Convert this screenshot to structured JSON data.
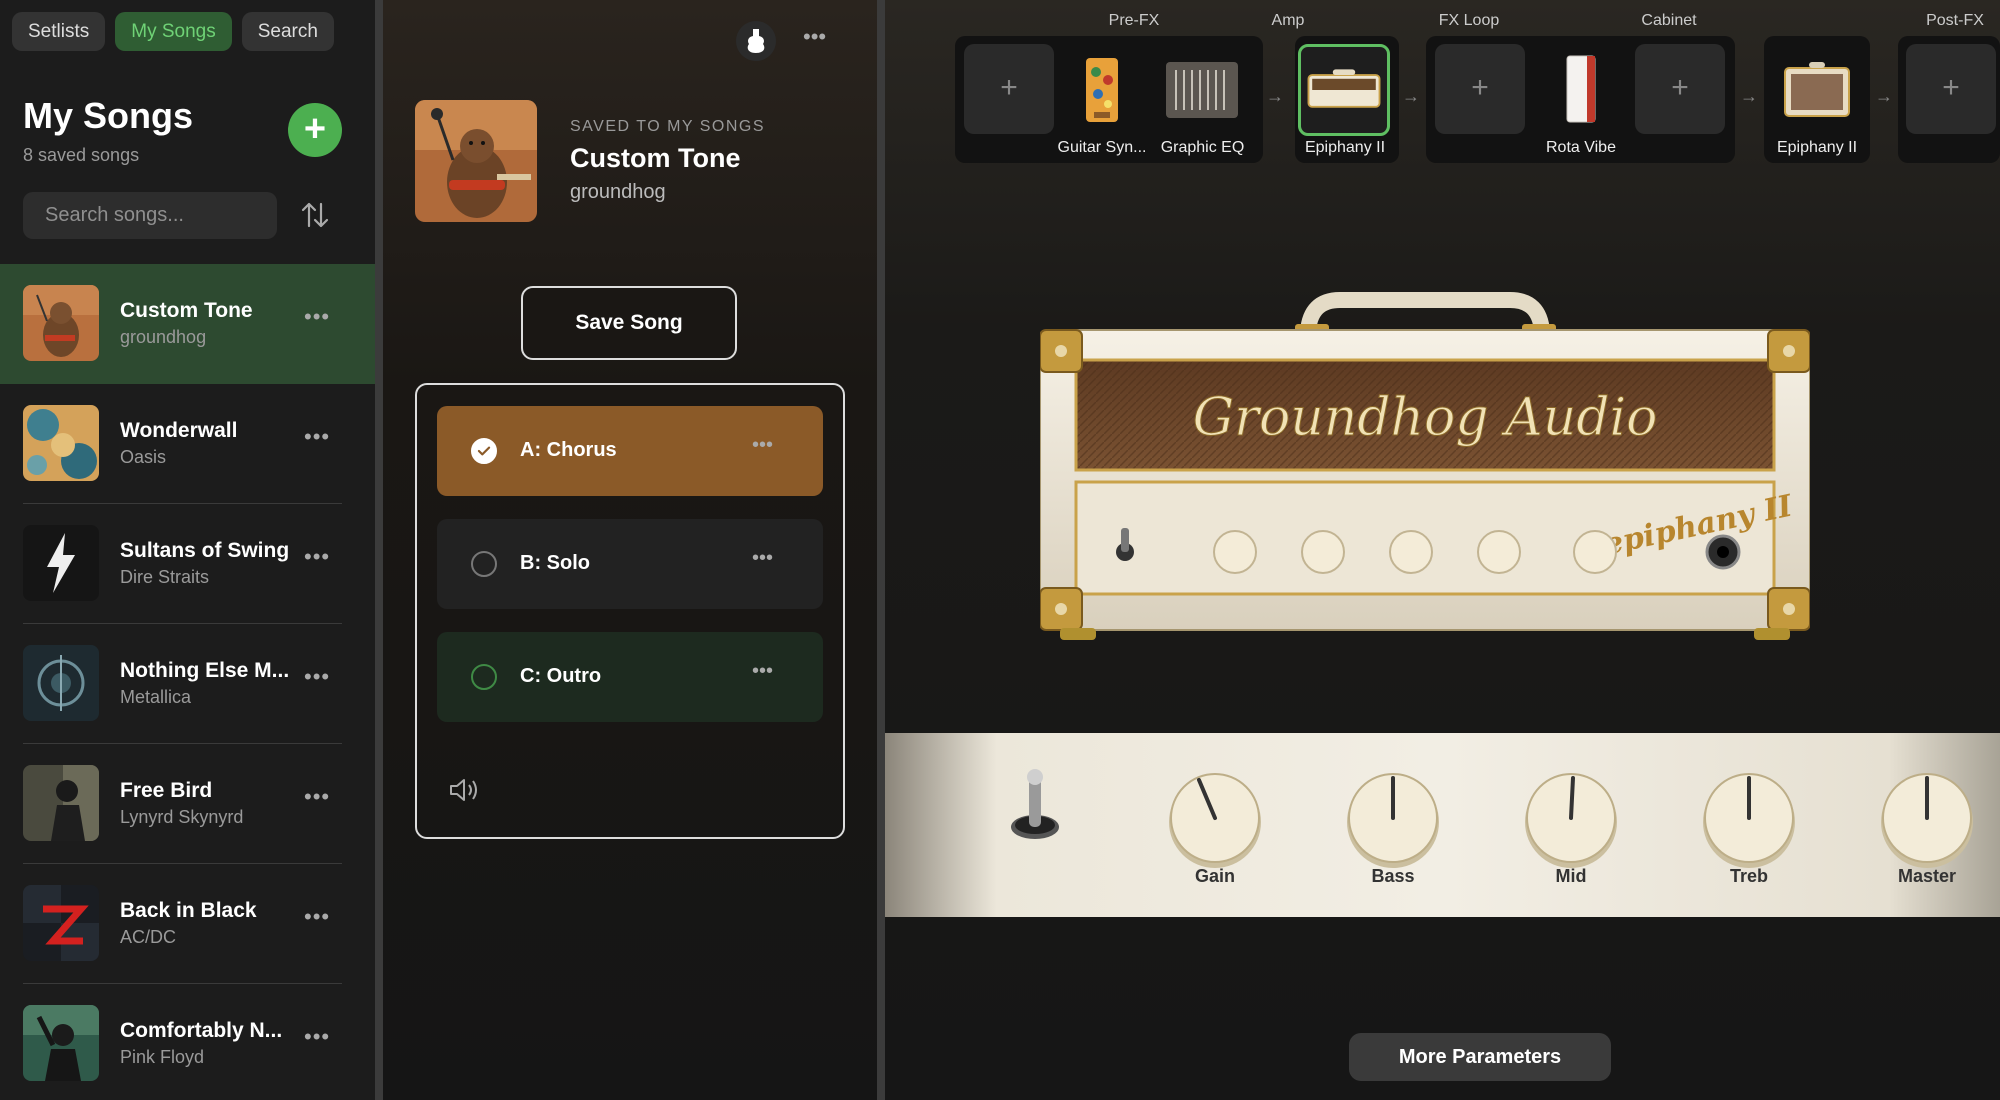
{
  "top_tabs": [
    {
      "label": "Setlists"
    },
    {
      "label": "My Songs"
    },
    {
      "label": "Search"
    }
  ],
  "sidebar": {
    "title": "My Songs",
    "count": "8 saved songs",
    "search_placeholder": "Search songs...",
    "songs": [
      {
        "title": "Custom Tone",
        "artist": "groundhog",
        "active": true
      },
      {
        "title": "Wonderwall",
        "artist": "Oasis"
      },
      {
        "title": "Sultans of Swing",
        "artist": "Dire Straits"
      },
      {
        "title": "Nothing Else M...",
        "artist": "Metallica"
      },
      {
        "title": "Free Bird",
        "artist": "Lynyrd Skynyrd"
      },
      {
        "title": "Back in Black",
        "artist": "AC/DC"
      },
      {
        "title": "Comfortably N...",
        "artist": "Pink Floyd"
      }
    ],
    "more_glyph": "•••"
  },
  "middle": {
    "saved_label": "SAVED TO MY SONGS",
    "title": "Custom Tone",
    "artist": "groundhog",
    "save_button": "Save Song",
    "more_glyph": "•••",
    "parts": [
      {
        "label": "A: Chorus",
        "state": "active"
      },
      {
        "label": "B: Solo",
        "state": "inactive"
      },
      {
        "label": "C: Outro",
        "state": "green"
      }
    ]
  },
  "chain": {
    "sections": {
      "prefx": "Pre-FX",
      "amp": "Amp",
      "fxloop": "FX Loop",
      "cabinet": "Cabinet",
      "postfx": "Post-FX"
    },
    "add_glyph": "+",
    "arrow_glyph": "→",
    "items": {
      "guitar_synth": "Guitar Syn...",
      "graphic_eq": "Graphic EQ",
      "amp": "Epiphany II",
      "rota_vibe": "Rota Vibe",
      "cabinet": "Epiphany II"
    }
  },
  "amp": {
    "brand": "Groundhog Audio",
    "model": "epiphany II"
  },
  "controls": {
    "knobs": [
      "Gain",
      "Bass",
      "Mid",
      "Treb",
      "Master"
    ]
  },
  "more_parameters": "More Parameters",
  "colors": {
    "accent_green": "#4caf50",
    "active_part": "#8b5a28",
    "selected_slot_border": "#5fbf62"
  }
}
